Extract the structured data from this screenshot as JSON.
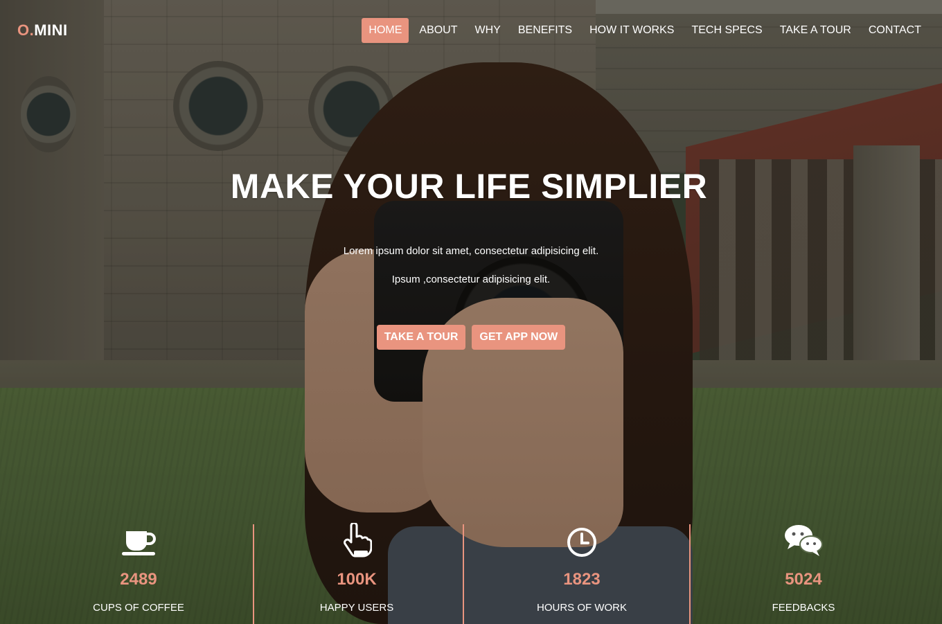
{
  "brand": {
    "prefix": "O.",
    "name": "MINI",
    "accent_color": "#e9947f"
  },
  "nav": {
    "items": [
      {
        "label": "HOME",
        "active": true
      },
      {
        "label": "ABOUT"
      },
      {
        "label": "WHY"
      },
      {
        "label": "BENEFITS"
      },
      {
        "label": "HOW IT WORKS"
      },
      {
        "label": "TECH SPECS"
      },
      {
        "label": "TAKE A TOUR"
      },
      {
        "label": "CONTACT"
      }
    ]
  },
  "hero": {
    "title": "MAKE YOUR LIFE SIMPLIER",
    "line1": "Lorem ipsum dolor sit amet, consectetur adipisicing elit.",
    "line2": "Ipsum ,consectetur adipisicing elit.",
    "buttons": {
      "tour": "TAKE A TOUR",
      "get_app": "GET APP NOW"
    }
  },
  "stats": [
    {
      "icon": "coffee-cup-icon",
      "value": "2489",
      "label": "CUPS OF COFFEE"
    },
    {
      "icon": "pointing-hand-icon",
      "value": "100K",
      "label": "HAPPY USERS"
    },
    {
      "icon": "clock-icon",
      "value": "1823",
      "label": "HOURS OF WORK"
    },
    {
      "icon": "chat-bubbles-icon",
      "value": "5024",
      "label": "FEEDBACKS"
    }
  ]
}
